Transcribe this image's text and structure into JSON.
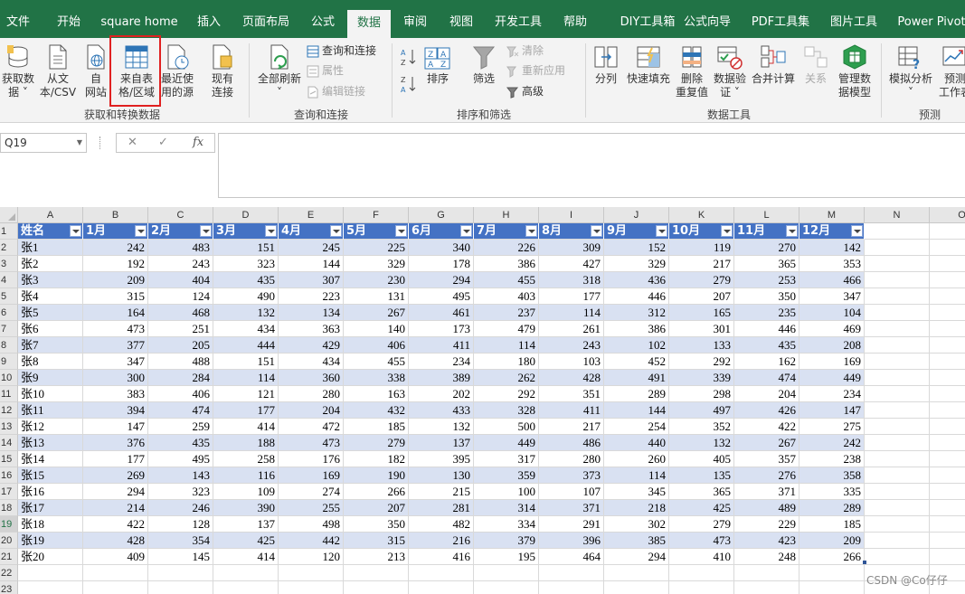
{
  "tabs": [
    {
      "label": "文件",
      "active": false
    },
    {
      "label": "开始",
      "active": false
    },
    {
      "label": "square home",
      "active": false
    },
    {
      "label": "插入",
      "active": false
    },
    {
      "label": "页面布局",
      "active": false
    },
    {
      "label": "公式",
      "active": false
    },
    {
      "label": "数据",
      "active": true
    },
    {
      "label": "审阅",
      "active": false
    },
    {
      "label": "视图",
      "active": false
    },
    {
      "label": "开发工具",
      "active": false
    },
    {
      "label": "帮助",
      "active": false
    },
    {
      "label": "DIY工具箱",
      "active": false
    },
    {
      "label": "公式向导",
      "active": false
    },
    {
      "label": "PDF工具集",
      "active": false
    },
    {
      "label": "图片工具",
      "active": false
    },
    {
      "label": "Power Pivot",
      "active": false
    }
  ],
  "ribbon": {
    "get_data": {
      "line1": "获取数",
      "line2": "据 ˅"
    },
    "from_text": {
      "line1": "从文",
      "line2": "本/CSV"
    },
    "from_web": {
      "line1": "自",
      "line2": "网站"
    },
    "from_table": {
      "line1": "来自表",
      "line2": "格/区域"
    },
    "recent_sources": {
      "line1": "最近使",
      "line2": "用的源"
    },
    "existing_conn": {
      "line1": "现有",
      "line2": "连接"
    },
    "group_get": "获取和转换数据",
    "refresh_all": {
      "line1": "全部刷新",
      "line2": "˅"
    },
    "queries_connections": "查询和连接",
    "properties": "属性",
    "edit_links": "编辑链接",
    "group_query": "查询和连接",
    "sort_az": "A↓Z",
    "sort_za": "Z↓A",
    "sort": "排序",
    "filter": "筛选",
    "clear": "清除",
    "reapply": "重新应用",
    "advanced": "高级",
    "group_sort": "排序和筛选",
    "split": "分列",
    "flash_fill": "快速填充",
    "remove_dup": {
      "line1": "删除",
      "line2": "重复值"
    },
    "validation": {
      "line1": "数据验",
      "line2": "证 ˅"
    },
    "consolidate": "合并计算",
    "relations": "关系",
    "data_model": {
      "line1": "管理数",
      "line2": "据模型"
    },
    "group_tools": "数据工具",
    "what_if": {
      "line1": "模拟分析",
      "line2": "˅"
    },
    "forecast": {
      "line1": "预测",
      "line2": "工作表"
    },
    "group_forecast": "预测"
  },
  "formula_bar": {
    "name_box": "Q19",
    "cancel": "✕",
    "enter": "✓",
    "fx": "fx",
    "content": ""
  },
  "sheet": {
    "columns": [
      "A",
      "B",
      "C",
      "D",
      "E",
      "F",
      "G",
      "H",
      "I",
      "J",
      "K",
      "L",
      "M",
      "N",
      "O"
    ],
    "row_numbers": [
      "1",
      "2",
      "3",
      "4",
      "5",
      "6",
      "7",
      "8",
      "9",
      "10",
      "11",
      "12",
      "13",
      "14",
      "15",
      "16",
      "17",
      "18",
      "19",
      "20",
      "21",
      "22",
      "23"
    ],
    "selected_row": "19",
    "headers": [
      "姓名",
      "1月",
      "2月",
      "3月",
      "4月",
      "5月",
      "6月",
      "7月",
      "8月",
      "9月",
      "10月",
      "11月",
      "12月"
    ],
    "rows": [
      [
        "张1",
        242,
        483,
        151,
        245,
        225,
        340,
        226,
        309,
        152,
        119,
        270,
        142
      ],
      [
        "张2",
        192,
        243,
        323,
        144,
        329,
        178,
        386,
        427,
        329,
        217,
        365,
        353
      ],
      [
        "张3",
        209,
        404,
        435,
        307,
        230,
        294,
        455,
        318,
        436,
        279,
        253,
        466
      ],
      [
        "张4",
        315,
        124,
        490,
        223,
        131,
        495,
        403,
        177,
        446,
        207,
        350,
        347
      ],
      [
        "张5",
        164,
        468,
        132,
        134,
        267,
        461,
        237,
        114,
        312,
        165,
        235,
        104
      ],
      [
        "张6",
        473,
        251,
        434,
        363,
        140,
        173,
        479,
        261,
        386,
        301,
        446,
        469
      ],
      [
        "张7",
        377,
        205,
        444,
        429,
        406,
        411,
        114,
        243,
        102,
        133,
        435,
        208
      ],
      [
        "张8",
        347,
        488,
        151,
        434,
        455,
        234,
        180,
        103,
        452,
        292,
        162,
        169
      ],
      [
        "张9",
        300,
        284,
        114,
        360,
        338,
        389,
        262,
        428,
        491,
        339,
        474,
        449
      ],
      [
        "张10",
        383,
        406,
        121,
        280,
        163,
        202,
        292,
        351,
        289,
        298,
        204,
        234
      ],
      [
        "张11",
        394,
        474,
        177,
        204,
        432,
        433,
        328,
        411,
        144,
        497,
        426,
        147
      ],
      [
        "张12",
        147,
        259,
        414,
        472,
        185,
        132,
        500,
        217,
        254,
        352,
        422,
        275
      ],
      [
        "张13",
        376,
        435,
        188,
        473,
        279,
        137,
        449,
        486,
        440,
        132,
        267,
        242
      ],
      [
        "张14",
        177,
        495,
        258,
        176,
        182,
        395,
        317,
        280,
        260,
        405,
        357,
        238
      ],
      [
        "张15",
        269,
        143,
        116,
        169,
        190,
        130,
        359,
        373,
        114,
        135,
        276,
        358
      ],
      [
        "张16",
        294,
        323,
        109,
        274,
        266,
        215,
        100,
        107,
        345,
        365,
        371,
        335
      ],
      [
        "张17",
        214,
        246,
        390,
        255,
        207,
        281,
        314,
        371,
        218,
        425,
        489,
        289
      ],
      [
        "张18",
        422,
        128,
        137,
        498,
        350,
        482,
        334,
        291,
        302,
        279,
        229,
        185
      ],
      [
        "张19",
        428,
        354,
        425,
        442,
        315,
        216,
        379,
        396,
        385,
        473,
        423,
        209
      ],
      [
        "张20",
        409,
        145,
        414,
        120,
        213,
        416,
        195,
        464,
        294,
        410,
        248,
        266
      ]
    ]
  },
  "colors": {
    "app_green": "#217346",
    "table_header": "#4472c4",
    "table_band": "#d9e1f2",
    "highlight_box": "#e02020"
  },
  "watermark": "CSDN @Co仔仔"
}
